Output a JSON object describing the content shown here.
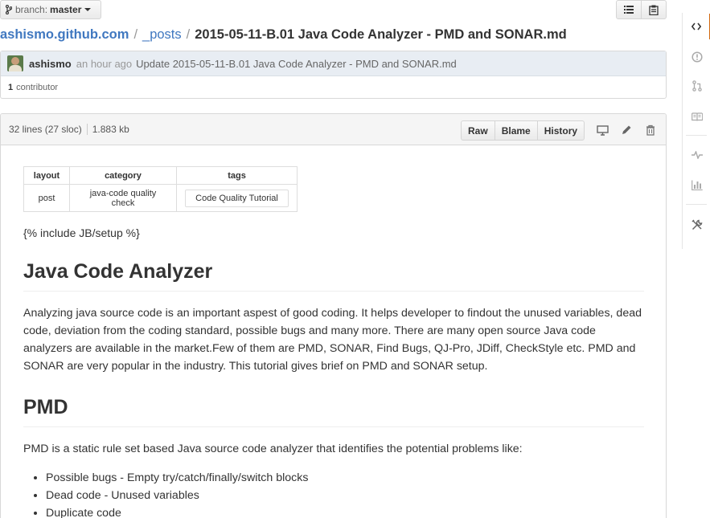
{
  "branch": {
    "prefix": "branch:",
    "name": "master"
  },
  "breadcrumb": {
    "repo": "ashismo.github.com",
    "folder": "_posts",
    "file": "2015-05-11-B.01 Java Code Analyzer - PMD and SONAR.md",
    "separator": "/"
  },
  "commit": {
    "author": "ashismo",
    "when": "an hour ago",
    "message": "Update 2015-05-11-B.01 Java Code Analyzer - PMD and SONAR.md",
    "contributor_count": "1",
    "contributor_label": "contributor"
  },
  "file_info": {
    "lines": "32 lines (27 sloc)",
    "size": "1.883 kb",
    "buttons": {
      "raw": "Raw",
      "blame": "Blame",
      "history": "History"
    }
  },
  "front_matter": {
    "headers": [
      "layout",
      "category",
      "tags"
    ],
    "row": [
      "post",
      "java-code quality check",
      "Code Quality Tutorial"
    ]
  },
  "content": {
    "include": "{% include JB/setup %}",
    "h1_title": "Java Code Analyzer",
    "intro": "Analyzing java source code is an important aspest of good coding. It helps developer to findout the unused variables, dead code, deviation from the coding standard, possible bugs and many more. There are many open source Java code analyzers are available in the market.Few of them are PMD, SONAR, Find Bugs, QJ-Pro, JDiff, CheckStyle etc. PMD and SONAR are very popular in the industry. This tutorial gives brief on PMD and SONAR setup.",
    "h1_pmd": "PMD",
    "pmd_desc": "PMD is a static rule set based Java source code analyzer that identifies the potential problems like:",
    "list": [
      "Possible bugs - Empty try/catch/finally/switch blocks",
      "Dead code - Unused variables",
      "Duplicate code"
    ]
  },
  "colors": {
    "link": "#4078c0",
    "active_tab": "#d26911",
    "commit_bg": "#e8edf3"
  },
  "sidebar_icons": [
    "code-icon",
    "issue-icon",
    "pull-request-icon",
    "wiki-icon",
    "pulse-icon",
    "graph-icon",
    "settings-icon"
  ]
}
